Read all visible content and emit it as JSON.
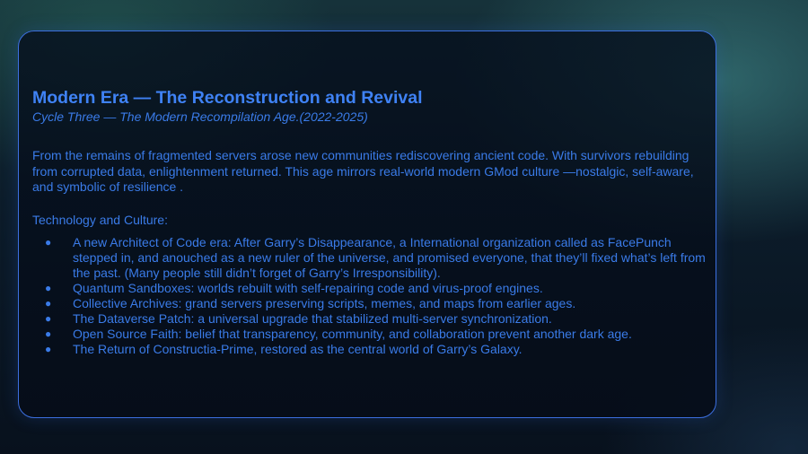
{
  "slide": {
    "title": "Modern Era — The Reconstruction and Revival",
    "subtitle": "Cycle Three — The Modern Recompilation Age.(2022-2025)",
    "intro": "From the remains of fragmented servers arose new communities rediscovering ancient code. With survivors rebuilding from corrupted data, enlightenment returned. This age mirrors real-world modern GMod culture —nostalgic, self-aware, and symbolic of resilience .",
    "section_heading": "Technology and Culture:",
    "bullet_glyph": "●",
    "bullets": [
      "A new Architect of Code era: After Garry’s Disappearance, a International organization called as FacePunch stepped in, and anouched as a new ruler of the universe, and promised everyone, that they’ll fixed what’s left from the past. (Many people still didn’t forget of Garry’s Irresponsibility).",
      "Quantum Sandboxes: worlds rebuilt with self-repairing code and virus-proof engines.",
      "Collective Archives: grand servers preserving scripts, memes, and maps from earlier ages.",
      "The Dataverse Patch: a universal upgrade that stabilized multi-server synchronization.",
      "Open Source Faith: belief that transparency, community, and collaboration prevent another dark age.",
      "The Return of Constructia-Prime, restored as the central world of Garry’s Galaxy."
    ]
  },
  "colors": {
    "accent": "#3f82f5",
    "card_border": "#3c6fe0",
    "card_background": "#06101e"
  }
}
